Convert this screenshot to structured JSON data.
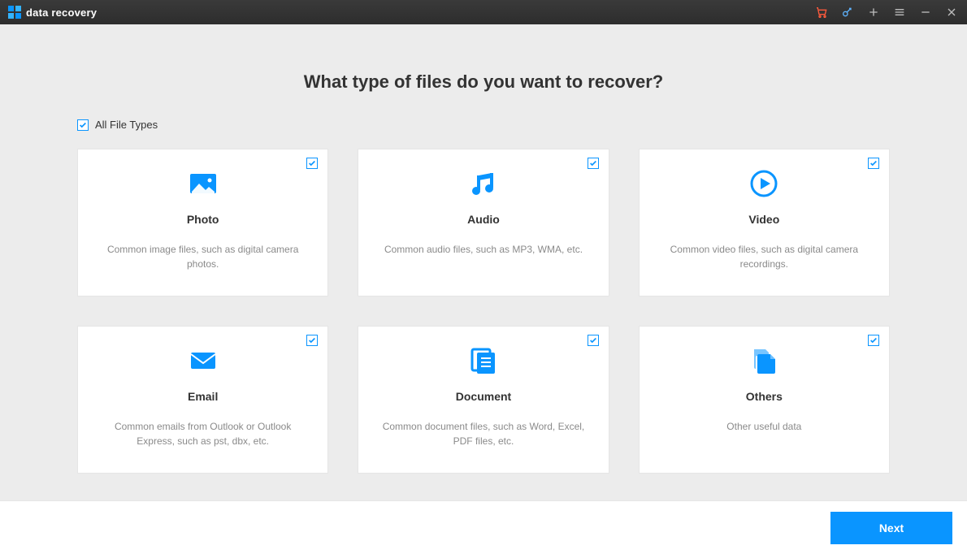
{
  "app": {
    "title": "data recovery"
  },
  "heading": "What type of files do you want to recover?",
  "all_types": {
    "label": "All File Types",
    "checked": true
  },
  "cards": [
    {
      "title": "Photo",
      "desc": "Common image files, such as digital camera photos.",
      "checked": true,
      "icon": "image-icon"
    },
    {
      "title": "Audio",
      "desc": "Common audio files, such as MP3, WMA, etc.",
      "checked": true,
      "icon": "music-icon"
    },
    {
      "title": "Video",
      "desc": "Common video files, such as digital camera recordings.",
      "checked": true,
      "icon": "play-circle-icon"
    },
    {
      "title": "Email",
      "desc": "Common emails from Outlook or Outlook Express, such as pst, dbx, etc.",
      "checked": true,
      "icon": "mail-icon"
    },
    {
      "title": "Document",
      "desc": "Common document files, such as Word, Excel, PDF files, etc.",
      "checked": true,
      "icon": "document-icon"
    },
    {
      "title": "Others",
      "desc": "Other useful data",
      "checked": true,
      "icon": "files-icon"
    }
  ],
  "footer": {
    "next": "Next"
  },
  "colors": {
    "accent": "#0a95ff"
  }
}
